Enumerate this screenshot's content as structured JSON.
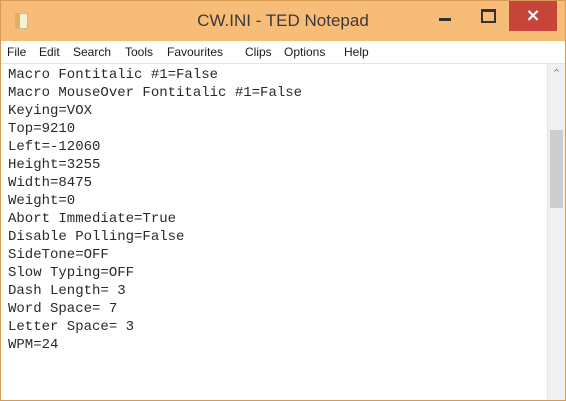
{
  "window": {
    "title": "CW.INI - TED Notepad",
    "minimize_icon": "minimize-icon",
    "maximize_icon": "maximize-icon",
    "close_icon": "close-icon",
    "close_glyph": "×"
  },
  "menu": {
    "items": [
      "File",
      "Edit",
      "Search",
      "Tools",
      "Favourites",
      "Clips",
      "Options",
      "Help"
    ]
  },
  "editor": {
    "lines": [
      "Macro Fontitalic #1=False",
      "Macro MouseOver Fontitalic #1=False",
      "Keying=VOX",
      "Top=9210",
      "Left=-12060",
      "Height=3255",
      "Width=8475",
      "Weight=0",
      "Abort Immediate=True",
      "Disable Polling=False",
      "SideTone=OFF",
      "Slow Typing=OFF",
      "Dash Length= 3",
      "Word Space= 7",
      "Letter Space= 3",
      "WPM=24"
    ]
  },
  "scrollbar": {
    "up_arrow": "^"
  }
}
